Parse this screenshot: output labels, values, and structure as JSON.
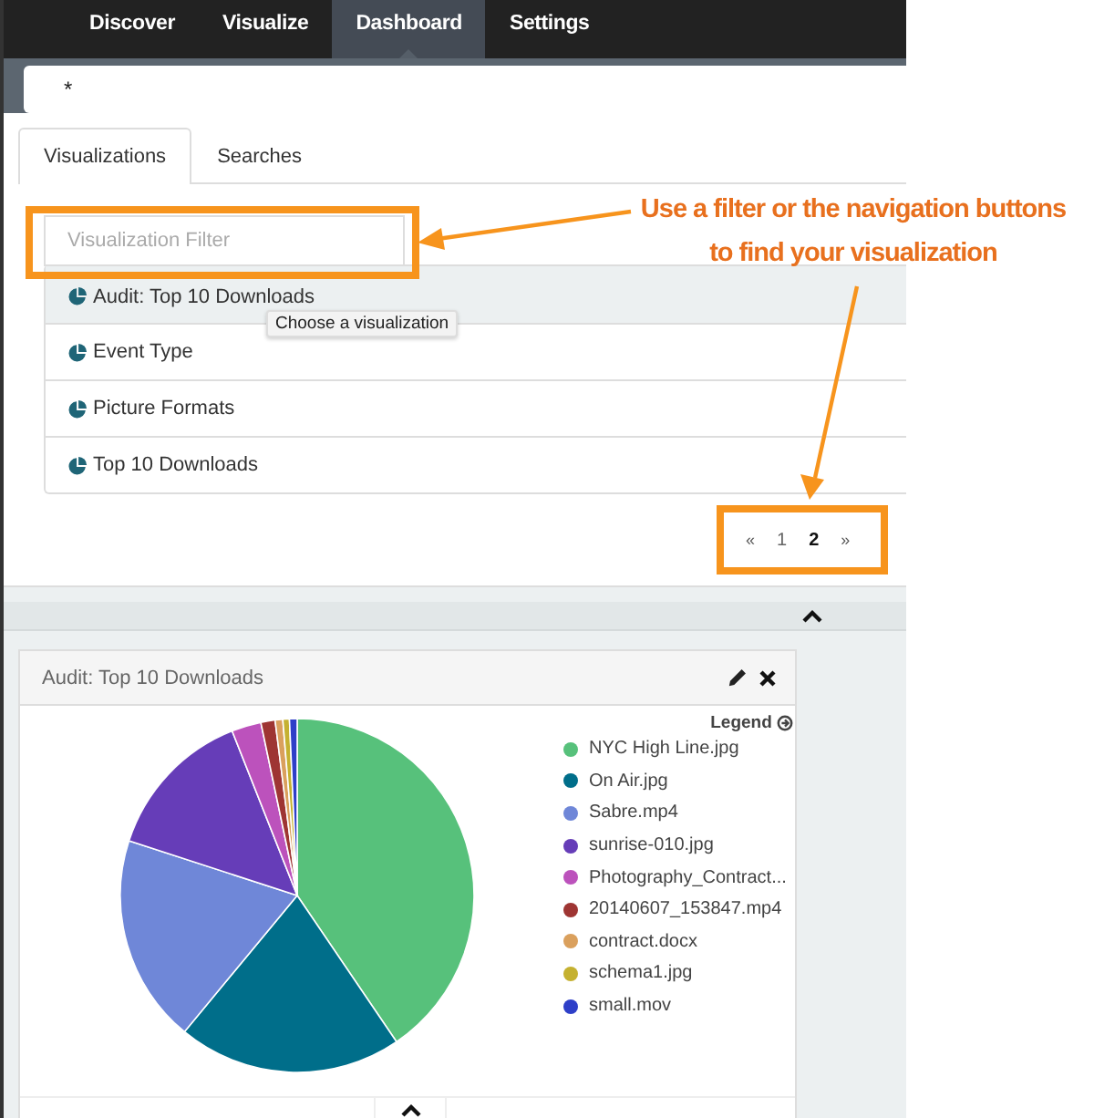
{
  "nav": {
    "items": [
      {
        "label": "Discover",
        "selected": false
      },
      {
        "label": "Visualize",
        "selected": false
      },
      {
        "label": "Dashboard",
        "selected": true
      },
      {
        "label": "Settings",
        "selected": false
      }
    ]
  },
  "query": {
    "value": "*"
  },
  "picker": {
    "tabs": [
      {
        "label": "Visualizations",
        "selected": true
      },
      {
        "label": "Searches",
        "selected": false
      }
    ],
    "filter": {
      "placeholder": "Visualization Filter"
    },
    "items": [
      {
        "label": "Audit: Top 10 Downloads",
        "selected": true
      },
      {
        "label": "Event Type",
        "selected": false
      },
      {
        "label": "Picture Formats",
        "selected": false
      },
      {
        "label": "Top 10 Downloads",
        "selected": false
      }
    ],
    "tooltip": "Choose a visualization",
    "pagination": {
      "prev": "«",
      "pages": [
        {
          "label": "1",
          "selected": false
        },
        {
          "label": "2",
          "selected": true
        }
      ],
      "next": "»"
    }
  },
  "annotation": {
    "text": "Use a filter or the navigation buttons to find your visualization"
  },
  "panel": {
    "title": "Audit: Top 10 Downloads",
    "legend": {
      "title": "Legend",
      "items": [
        {
          "label": "NYC High Line.jpg",
          "color": "#57c17b"
        },
        {
          "label": "On Air.jpg",
          "color": "#006e8a"
        },
        {
          "label": "Sabre.mp4",
          "color": "#6f87d8"
        },
        {
          "label": "sunrise-010.jpg",
          "color": "#663db8"
        },
        {
          "label": "Photography_Contract...",
          "color": "#bc52bc"
        },
        {
          "label": "20140607_153847.mp4",
          "color": "#9e3533"
        },
        {
          "label": "contract.docx",
          "color": "#daa05d"
        },
        {
          "label": "schema1.jpg",
          "color": "#c5b130"
        },
        {
          "label": "small.mov",
          "color": "#2e3fc8"
        }
      ]
    }
  }
}
